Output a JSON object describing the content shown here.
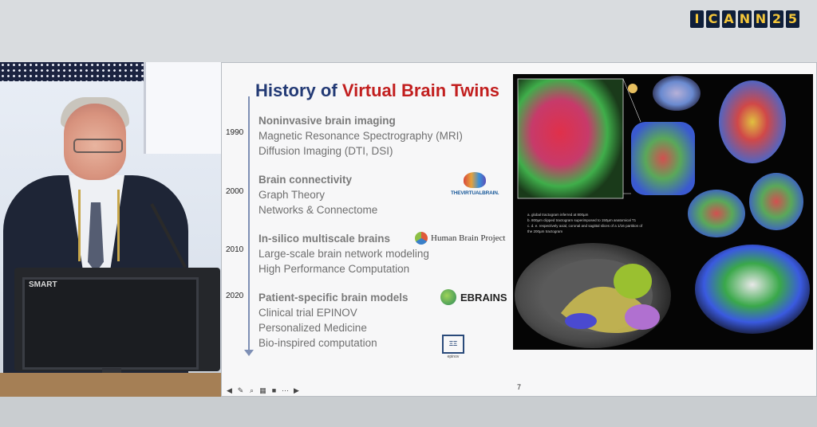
{
  "conference_logo": [
    "I",
    "C",
    "A",
    "N",
    "N",
    "2",
    "5"
  ],
  "slide": {
    "title_part1": "History of",
    "title_part2": "Virtual Brain Twins",
    "page_number": "7",
    "sections": [
      {
        "year": "1990",
        "heading": "Noninvasive brain imaging",
        "lines": [
          "Magnetic Resonance Spectrography (MRI)",
          "Diffusion Imaging (DTI, DSI)"
        ]
      },
      {
        "year": "2000",
        "heading": "Brain connectivity",
        "lines": [
          "Graph Theory",
          "Networks & Connectome"
        ]
      },
      {
        "year": "2010",
        "heading": "In-silico multiscale brains",
        "lines": [
          "Large-scale brain network modeling",
          "High Performance Computation"
        ]
      },
      {
        "year": "2020",
        "heading": "Patient-specific brain models",
        "lines": [
          "Clinical trial EPINOV",
          "Personalized Medicine",
          "Bio-inspired computation"
        ]
      }
    ],
    "logos": {
      "tvb": "THEVIRTUALBRAIN.",
      "hbp": "Human Brain Project",
      "ebrains": "EBRAINS",
      "epinov": "epinov"
    },
    "caption_lines": [
      "a. global tractogram inferred at 800µm",
      "b. 800µm clipped tractogram superimposed to 150µm anatomical T1",
      "c. d. e. respectively axial, coronal and sagittal slices of a 1/16 partition of the 200µm tractogram"
    ]
  },
  "video": {
    "monitor_brand": "SMART"
  },
  "colors": {
    "title_blue": "#233a75",
    "title_red": "#c21f1f",
    "logo_bg": "#0f1f3a",
    "logo_fg": "#f2c53a"
  }
}
